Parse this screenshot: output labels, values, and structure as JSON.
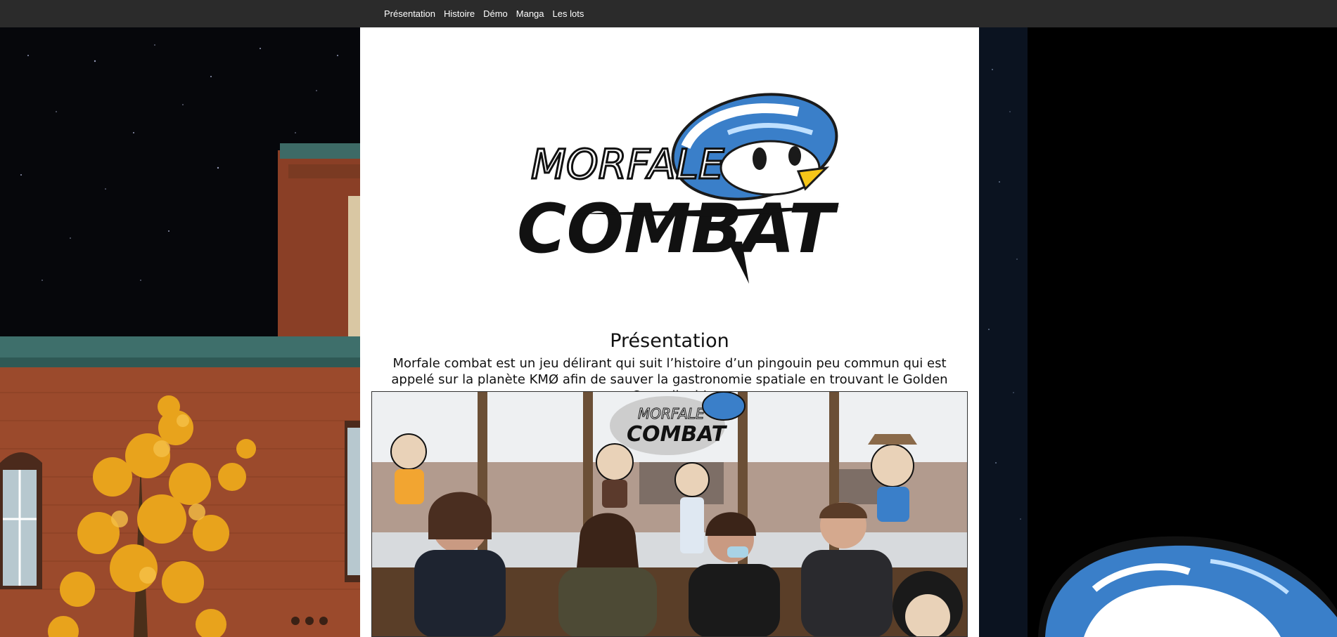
{
  "nav": {
    "items": [
      {
        "label": "Présentation"
      },
      {
        "label": "Histoire"
      },
      {
        "label": "Démo"
      },
      {
        "label": "Manga"
      },
      {
        "label": "Les lots"
      }
    ]
  },
  "logo": {
    "line1": "MORFALE",
    "line2": "COMBAT"
  },
  "presentation": {
    "title": "Présentation",
    "text": "Morfale combat est un jeu délirant qui suit l’histoire d’un pingouin peu commun qui est appelé sur la planète KMØ afin de sauver la gastronomie spatiale en trouvant le Golden Cannelloni !"
  },
  "photo": {
    "logo_line1": "MORFALE",
    "logo_line2": "COMBAT"
  },
  "colors": {
    "navbar": "#2b2b2b",
    "penguin_blue": "#3a7fc9",
    "beak_yellow": "#f5c518",
    "brick": "#9b4a2c",
    "foliage": "#e8a31c"
  }
}
